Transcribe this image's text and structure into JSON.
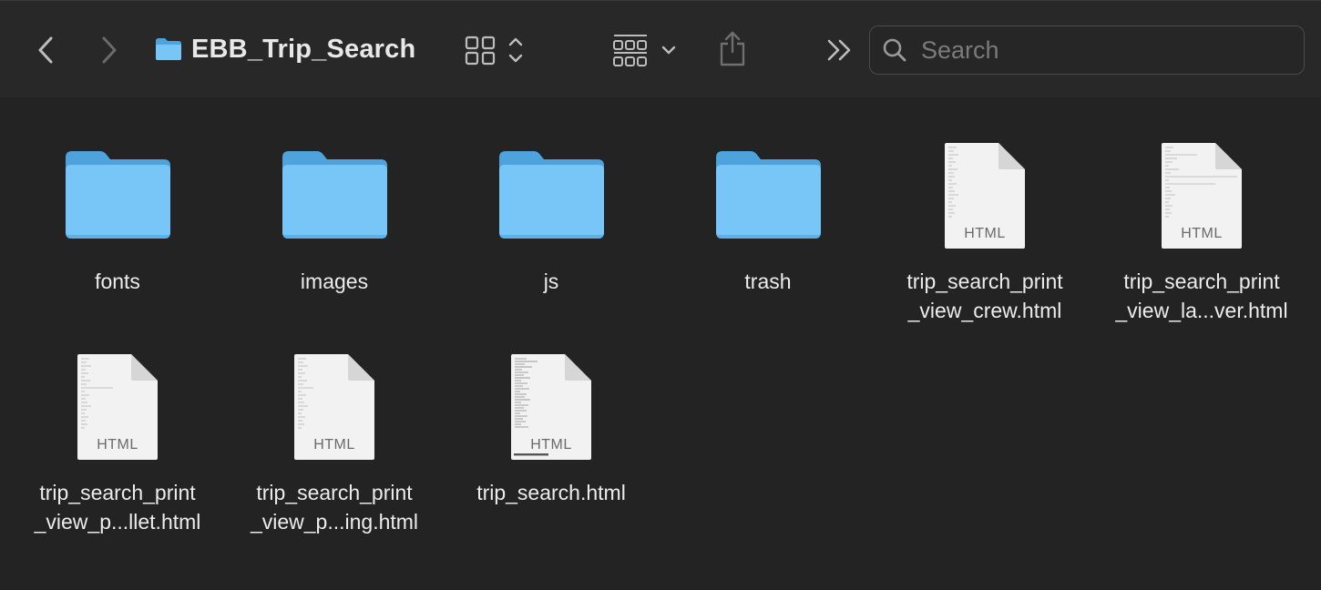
{
  "window": {
    "title": "EBB_Trip_Search"
  },
  "toolbar": {
    "back_icon": "chevron-left-icon",
    "forward_icon": "chevron-right-icon",
    "view_icon": "grid-view-icon",
    "group_icon": "group-by-icon",
    "share_icon": "share-icon",
    "more_icon": "double-chevron-right-icon"
  },
  "search": {
    "placeholder": "Search",
    "value": ""
  },
  "items": [
    {
      "kind": "folder",
      "label": "fonts"
    },
    {
      "kind": "folder",
      "label": "images"
    },
    {
      "kind": "folder",
      "label": "js"
    },
    {
      "kind": "folder",
      "label": "trash"
    },
    {
      "kind": "html",
      "label": "trip_search_print\n_view_crew.html",
      "tag": "HTML"
    },
    {
      "kind": "html",
      "label": "trip_search_print\n_view_la...ver.html",
      "tag": "HTML"
    },
    {
      "kind": "html",
      "label": "trip_search_print\n_view_p...llet.html",
      "tag": "HTML"
    },
    {
      "kind": "html",
      "label": "trip_search_print\n_view_p...ing.html",
      "tag": "HTML"
    },
    {
      "kind": "html",
      "label": "trip_search.html",
      "tag": "HTML"
    }
  ],
  "colors": {
    "folder_front": "#78c5f7",
    "folder_back": "#4fa3dd",
    "background": "#232323",
    "toolbar": "#282828"
  }
}
